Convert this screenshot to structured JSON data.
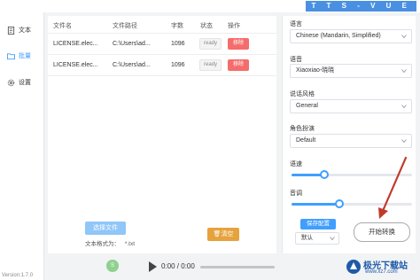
{
  "titlebar": {
    "title": "T T S - V U E"
  },
  "sidebar": {
    "items": [
      {
        "label": "文本",
        "icon": "document-icon"
      },
      {
        "label": "批量",
        "icon": "folder-icon"
      },
      {
        "label": "设置",
        "icon": "gear-icon"
      }
    ],
    "active_index": 1,
    "version": "Version:1.7.0"
  },
  "table": {
    "headers": [
      "文件名",
      "文件路径",
      "字数",
      "状态",
      "操作"
    ],
    "rows": [
      {
        "name": "LICENSE.elec...",
        "path": "C:\\Users\\ad...",
        "count": "1096",
        "status": "ready",
        "action": "移除"
      },
      {
        "name": "LICENSE.elec...",
        "path": "C:\\Users\\ad...",
        "count": "1096",
        "status": "ready",
        "action": "移除"
      }
    ]
  },
  "actions": {
    "choose_file": "选择文件",
    "format_label": "文本格式为：",
    "format_value": "*.txt",
    "clear": "清空"
  },
  "player": {
    "time": "0:00 / 0:00",
    "progress": 0
  },
  "settings": {
    "language_label": "语言",
    "language_value": "Chinese (Mandarin, Simplified)",
    "voice_label": "语音",
    "voice_value": "Xiaoxiao-晓晓",
    "style_label": "说话风格",
    "style_value": "General",
    "role_label": "角色扮演",
    "role_value": "Default",
    "rate_label": "语速",
    "rate_value": 0.27,
    "pitch_label": "音调",
    "pitch_value": 0.4,
    "save_config": "保存配置",
    "preset_value": "默认",
    "start": "开始转换"
  },
  "watermark": {
    "title": "极光下载站",
    "url": "www.xz7.com"
  },
  "colors": {
    "accent": "#409eff",
    "danger": "#f56c6c",
    "warning": "#e6a23c",
    "annotation": "#c0392b"
  }
}
